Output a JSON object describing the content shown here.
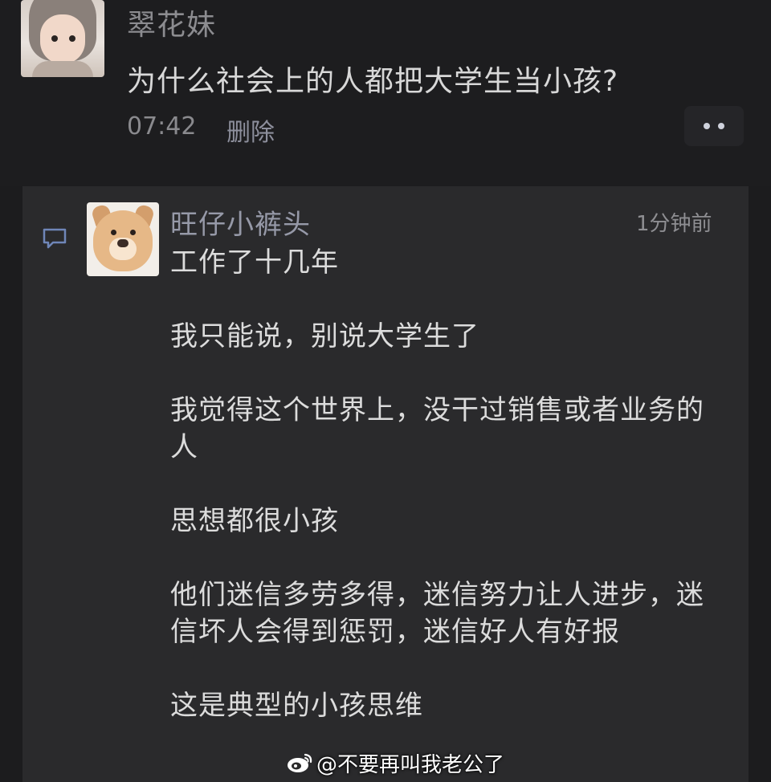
{
  "post": {
    "username": "翠花妹",
    "text": "为什么社会上的人都把大学生当小孩?",
    "time": "07:42",
    "delete_label": "删除",
    "more_icon": "more-dots-icon"
  },
  "comment": {
    "username": "旺仔小裤头",
    "time": "1分钟前",
    "icon": "comment-bubble-icon",
    "paragraphs": [
      "工作了十几年",
      "我只能说，别说大学生了",
      "我觉得这个世界上，没干过销售或者业务的人",
      "思想都很小孩",
      "他们迷信多劳多得，迷信努力让人进步，迷信坏人会得到惩罚，迷信好人有好报",
      "这是典型的小孩思维"
    ]
  },
  "watermark": {
    "logo_icon": "weibo-logo-icon",
    "text": "@不要再叫我老公了"
  },
  "colors": {
    "background": "#1c1c1e",
    "panel": "#2a2a2c",
    "username": "#9699a8",
    "text": "#dcdcdc"
  }
}
